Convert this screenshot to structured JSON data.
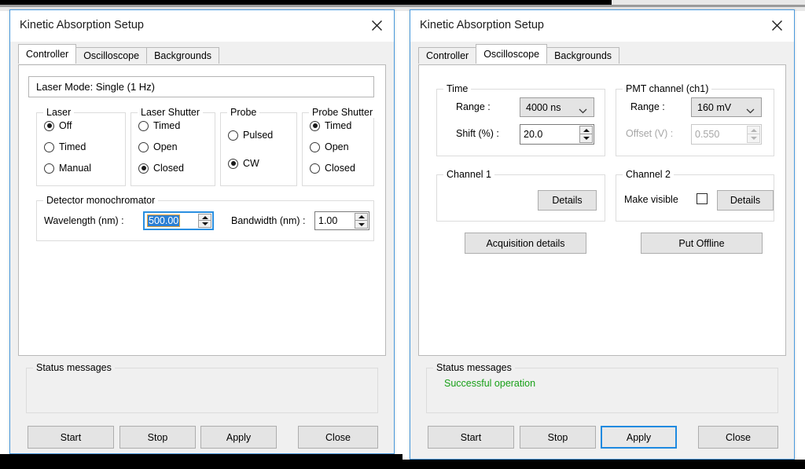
{
  "window_title": "Kinetic Absorption Setup",
  "tabs": [
    "Controller",
    "Oscilloscope",
    "Backgrounds"
  ],
  "icons": {
    "close": "close-icon",
    "chevron_down": "chevron-down-icon",
    "spin_up": "triangle-up-icon",
    "spin_down": "triangle-down-icon"
  },
  "colors": {
    "window_border": "#4a9ade",
    "accent_focus": "#2a8fe0",
    "selection_blue": "#2a7fd4",
    "status_success": "#18a018",
    "face": "#f0f0f0",
    "button_face": "#e4e4e4",
    "disabled_text": "#a6a6a6"
  },
  "left_dialog": {
    "title": "Kinetic Absorption Setup",
    "selected_tab": "Controller",
    "laser_mode_banner": "Laser Mode: Single (1 Hz)",
    "groups": {
      "laser": {
        "label": "Laser",
        "options": [
          "Off",
          "Timed",
          "Manual"
        ],
        "selected": "Off"
      },
      "laser_shutter": {
        "label": "Laser Shutter",
        "options": [
          "Timed",
          "Open",
          "Closed"
        ],
        "selected": "Closed"
      },
      "probe": {
        "label": "Probe",
        "options": [
          "Pulsed",
          "CW"
        ],
        "selected": "CW"
      },
      "probe_shutter": {
        "label": "Probe Shutter",
        "options": [
          "Timed",
          "Open",
          "Closed"
        ],
        "selected": "Timed"
      },
      "detector_monochromator": {
        "label": "Detector monochromator",
        "wavelength_label": "Wavelength (nm) :",
        "wavelength_value": "500.00",
        "wavelength_selected": true,
        "bandwidth_label": "Bandwidth (nm) :",
        "bandwidth_value": "1.00"
      }
    },
    "status": {
      "label": "Status messages",
      "message": ""
    },
    "buttons": {
      "start": "Start",
      "stop": "Stop",
      "apply": "Apply",
      "close": "Close",
      "default": ""
    }
  },
  "right_dialog": {
    "title": "Kinetic Absorption Setup",
    "selected_tab": "Oscilloscope",
    "groups": {
      "time": {
        "label": "Time",
        "range_label": "Range :",
        "range_value": "4000 ns",
        "shift_label": "Shift (%) :",
        "shift_value": "20.0"
      },
      "pmt_channel": {
        "label": "PMT channel (ch1)",
        "range_label": "Range :",
        "range_value": "160 mV",
        "offset_label": "Offset (V) :",
        "offset_value": "0.550",
        "offset_disabled": true
      },
      "channel1": {
        "label": "Channel 1",
        "details_button": "Details"
      },
      "channel2": {
        "label": "Channel 2",
        "make_visible_label": "Make visible",
        "make_visible_checked": false,
        "details_button": "Details"
      }
    },
    "acquisition_details_button": "Acquisition details",
    "put_offline_button": "Put Offline",
    "status": {
      "label": "Status messages",
      "message": "Successful operation"
    },
    "buttons": {
      "start": "Start",
      "stop": "Stop",
      "apply": "Apply",
      "close": "Close",
      "default": "Apply"
    }
  }
}
